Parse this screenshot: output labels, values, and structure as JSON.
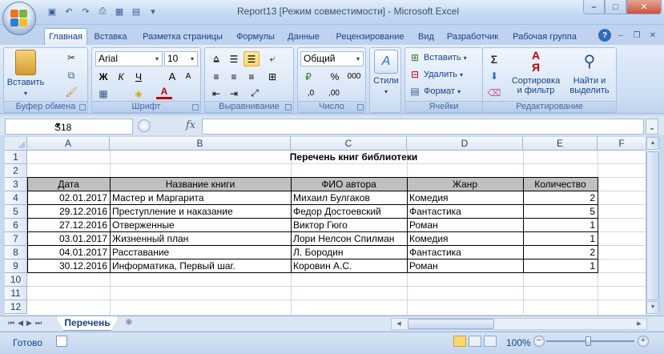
{
  "window": {
    "title": "Report13  [Режим совместимости] - Microsoft Excel",
    "min": "–",
    "max": "□",
    "close": "✕"
  },
  "ribbon_tabs": [
    "Главная",
    "Вставка",
    "Разметка страницы",
    "Формулы",
    "Данные",
    "Рецензирование",
    "Вид",
    "Разработчик",
    "Рабочая группа"
  ],
  "ribbon": {
    "clipboard": {
      "label": "Буфер обмена",
      "paste": "Вставить"
    },
    "font": {
      "label": "Шрифт",
      "name": "Arial",
      "size": "10",
      "bold": "Ж",
      "italic": "К",
      "underline": "Ч",
      "grow": "A",
      "shrink": "A"
    },
    "alignment": {
      "label": "Выравнивание"
    },
    "number": {
      "label": "Число",
      "format": "Общий",
      "percent": "%",
      "thousands": "000",
      "inc": ",0",
      "dec": ",00"
    },
    "styles": {
      "label": "Стили"
    },
    "cells": {
      "label": "Ячейки",
      "insert": "Вставить",
      "delete": "Удалить",
      "format": "Формат"
    },
    "editing": {
      "label": "Редактирование",
      "sum": "Σ",
      "sort": "Сортировка и фильтр",
      "find": "Найти и выделить"
    }
  },
  "formula_bar": {
    "name_box": "S18",
    "fx": "fx",
    "formula": ""
  },
  "columns": [
    "A",
    "B",
    "C",
    "D",
    "E",
    "F"
  ],
  "rows": [
    "1",
    "2",
    "3",
    "4",
    "5",
    "6",
    "7",
    "8",
    "9",
    "10",
    "11",
    "12"
  ],
  "sheet": {
    "title": "Перечень  книг библиотеки",
    "headers": [
      "Дата",
      "Название книги",
      "ФИО автора",
      "Жанр",
      "Количество"
    ],
    "data": [
      [
        "02.01.2017",
        "Мастер и Маргарита",
        "Михаил Булгаков",
        "Комедия",
        "2"
      ],
      [
        "29.12.2016",
        "Преступление и наказание",
        "Федор Достоевский",
        "Фантастика",
        "5"
      ],
      [
        "27.12.2016",
        "Отверженные",
        "Виктор Гюго",
        "Роман",
        "1"
      ],
      [
        "03.01.2017",
        "Жизненный план",
        "Лори Нелсон Спилман",
        "Комедия",
        "1"
      ],
      [
        "04.01.2017",
        "Расставание",
        "Л. Бородин",
        "Фантастика",
        "2"
      ],
      [
        "30.12.2016",
        "Информатика, Первый шаг.",
        "Коровин А.С.",
        "Роман",
        "1"
      ]
    ]
  },
  "sheet_tabs": [
    "Перечень"
  ],
  "status": {
    "ready": "Готово",
    "zoom": "100%",
    "minus": "−",
    "plus": "+"
  },
  "colors": {
    "header_fill": "#c0c0c0",
    "accent": "#15428b"
  }
}
